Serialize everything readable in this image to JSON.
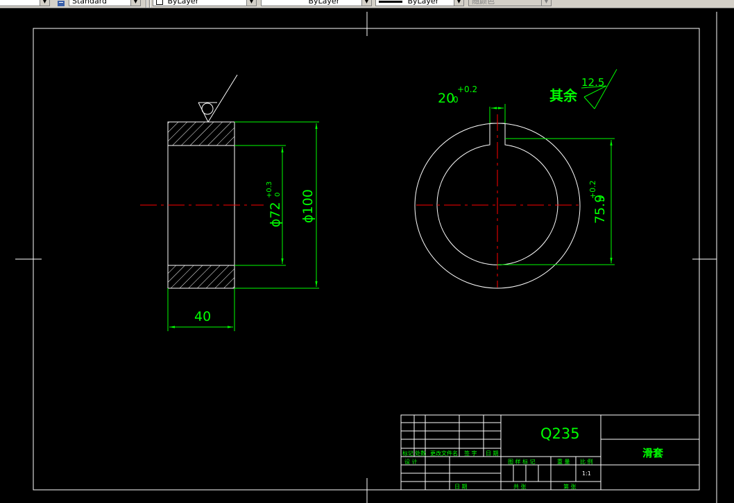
{
  "toolbar": {
    "combo1_value": "",
    "text_style_value": "Standard",
    "layer_value": "ByLayer",
    "linetype_value": "ByLayer",
    "lineweight_value": "ByLayer",
    "plotstyle_value": "随颜色"
  },
  "drawing": {
    "left_view": {
      "dim_inner": "ϕ72",
      "dim_inner_tol_upper": "+0.3",
      "dim_inner_tol_lower": "0",
      "dim_outer": "ϕ100",
      "dim_width": "40"
    },
    "right_view": {
      "dim_keyway": "20",
      "dim_keyway_tol_upper": "+0.2",
      "dim_keyway_tol_lower": "0",
      "dim_depth": "75.9",
      "dim_depth_tol_upper": "+0.2",
      "dim_depth_tol_lower": "0",
      "roughness_label": "其余",
      "roughness_value": "12.5"
    },
    "title_block": {
      "material": "Q235",
      "part_name": "滑套",
      "labels_row1": [
        "标记",
        "处数",
        "更改文件名",
        "签  字",
        "日 期"
      ],
      "labels_row2": [
        "设  计"
      ],
      "labels_mid": [
        "图 样 标 记",
        "重 量",
        "比 例"
      ],
      "scale": "1:1",
      "labels_bottom_left": [
        "日 期"
      ],
      "labels_bottom_mid": [
        "共  张",
        "第  张"
      ]
    }
  },
  "colors": {
    "background": "#000000",
    "frame": "#ffffff",
    "dimension": "#00ff00",
    "centerline": "#ff0000",
    "toolbar": "#d4d0c8"
  }
}
